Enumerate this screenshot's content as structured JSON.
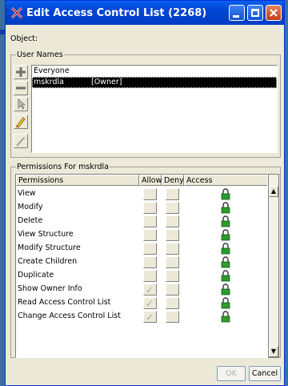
{
  "window": {
    "title": "Edit Access Control List (2268)",
    "accent": "#0a5fef"
  },
  "object_label": "Object:",
  "users": {
    "legend": "User Names",
    "items": [
      {
        "name": "Everyone",
        "tag": "",
        "selected": false
      },
      {
        "name": "mskrdla",
        "tag": "[Owner]",
        "selected": true
      }
    ],
    "tools": [
      "add-icon",
      "remove-icon",
      "cursor-icon",
      "edit-pencil-icon",
      "wand-icon"
    ]
  },
  "permissions": {
    "legend": "Permissions For mskrdla",
    "headers": {
      "permissions": "Permissions",
      "allow": "Allow",
      "deny": "Deny",
      "access": "Access"
    },
    "rows": [
      {
        "name": "View",
        "allow": false,
        "deny": false
      },
      {
        "name": "Modify",
        "allow": false,
        "deny": false
      },
      {
        "name": "Delete",
        "allow": false,
        "deny": false
      },
      {
        "name": "View Structure",
        "allow": false,
        "deny": false
      },
      {
        "name": "Modify Structure",
        "allow": false,
        "deny": false
      },
      {
        "name": "Create Children",
        "allow": false,
        "deny": false
      },
      {
        "name": "Duplicate",
        "allow": false,
        "deny": false
      },
      {
        "name": "Show Owner Info",
        "allow": true,
        "deny": false
      },
      {
        "name": "Read Access Control List",
        "allow": true,
        "deny": false
      },
      {
        "name": "Change Access Control List",
        "allow": true,
        "deny": false
      }
    ],
    "access_icon": "lock-icon",
    "access_color": "#2a9d2a"
  },
  "buttons": {
    "ok": "OK",
    "cancel": "Cancel"
  }
}
